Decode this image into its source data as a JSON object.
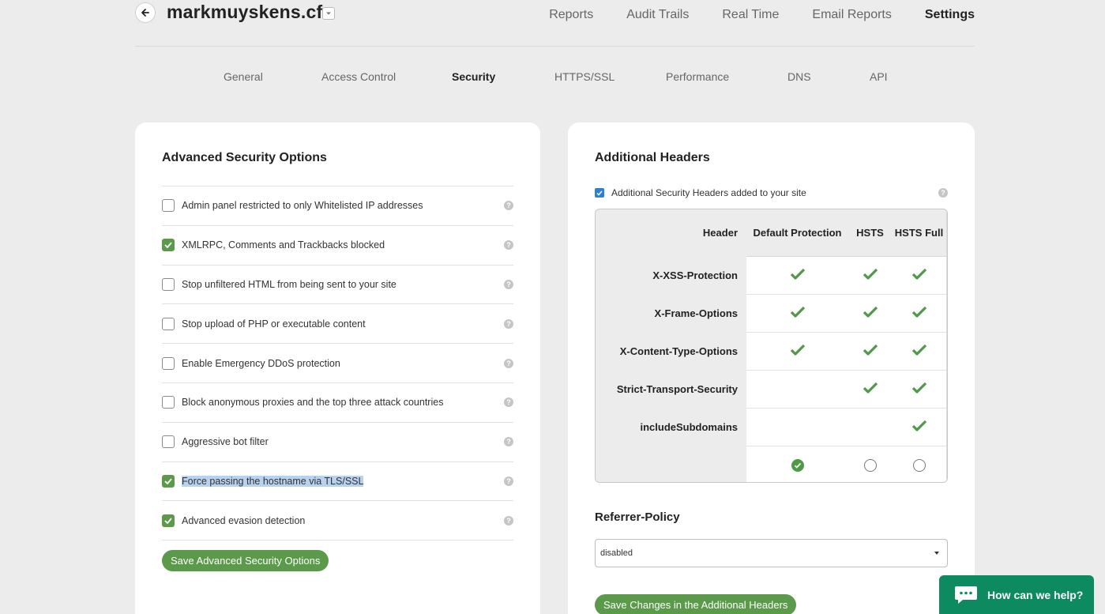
{
  "header": {
    "site_name": "markmuyskens.cf",
    "nav": [
      "Reports",
      "Audit Trails",
      "Real Time",
      "Email Reports",
      "Settings"
    ],
    "active_nav": "Settings"
  },
  "subnav": {
    "tabs": [
      "General",
      "Access Control",
      "Security",
      "HTTPS/SSL",
      "Performance",
      "DNS",
      "API"
    ],
    "active": "Security"
  },
  "advanced": {
    "title": "Advanced Security Options",
    "options": [
      {
        "label": "Admin panel restricted to only Whitelisted IP addresses",
        "checked": false
      },
      {
        "label": "XMLRPC, Comments and Trackbacks blocked",
        "checked": true
      },
      {
        "label": "Stop unfiltered HTML from being sent to your site",
        "checked": false
      },
      {
        "label": "Stop upload of PHP or executable content",
        "checked": false
      },
      {
        "label": "Enable Emergency DDoS protection",
        "checked": false
      },
      {
        "label": "Block anonymous proxies and the top three attack countries",
        "checked": false
      },
      {
        "label": "Aggressive bot filter",
        "checked": false
      },
      {
        "label": "Force passing the hostname via TLS/SSL",
        "checked": true,
        "selected_text": true
      },
      {
        "label": "Advanced evasion detection",
        "checked": true
      }
    ],
    "save_label": "Save Advanced Security Options",
    "help_glyph": "?"
  },
  "headers": {
    "title": "Additional Headers",
    "enable_label": "Additional Security Headers added to your site",
    "enabled": true,
    "table": {
      "col_header": "Header",
      "col_default": "Default Protection",
      "col_hsts": "HSTS",
      "col_hsts_full": "HSTS Full",
      "rows": [
        {
          "name": "X-XSS-Protection",
          "default": true,
          "hsts": true,
          "full": true
        },
        {
          "name": "X-Frame-Options",
          "default": true,
          "hsts": true,
          "full": true
        },
        {
          "name": "X-Content-Type-Options",
          "default": true,
          "hsts": true,
          "full": true
        },
        {
          "name": "Strict-Transport-Security",
          "default": false,
          "hsts": true,
          "full": true
        },
        {
          "name": "includeSubdomains",
          "default": false,
          "hsts": false,
          "full": true
        }
      ],
      "selected_profile": "Default Protection"
    },
    "referrer_title": "Referrer-Policy",
    "referrer_value": "disabled",
    "save_label": "Save Changes in the Additional Headers"
  },
  "chat": {
    "label": "How can we help?"
  },
  "colors": {
    "green": "#5a9a4a",
    "check_green": "#4e9a47",
    "chat_green": "#0d8a5f",
    "blue_checkbox": "#2f7fd8"
  }
}
